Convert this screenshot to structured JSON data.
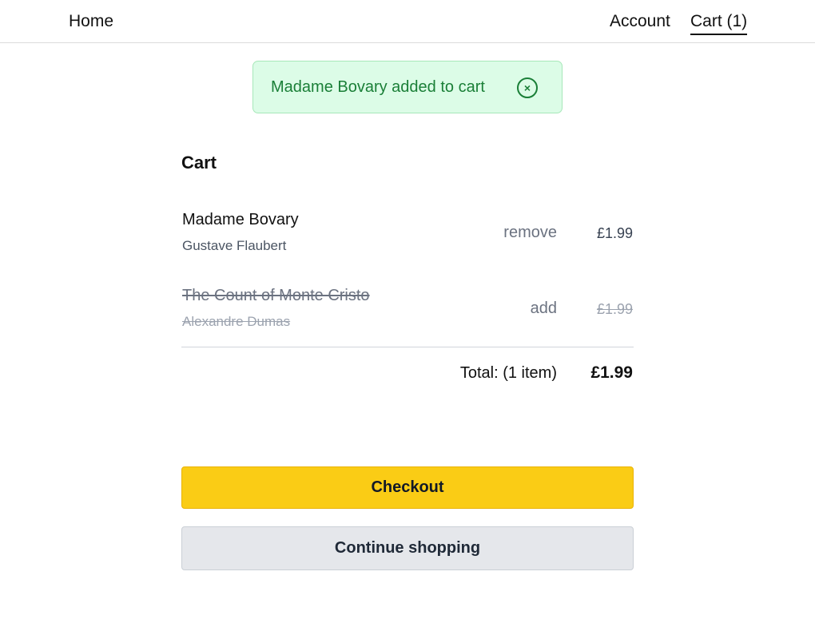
{
  "nav": {
    "home_label": "Home",
    "account_label": "Account",
    "cart_label": "Cart (1)"
  },
  "toast": {
    "message": "Madame Bovary added to cart",
    "close_glyph": "×",
    "background_color": "#dcfce7",
    "text_color": "#1a7f37"
  },
  "cart": {
    "title": "Cart",
    "items": [
      {
        "title": "Madame Bovary",
        "author": "Gustave Flaubert",
        "action_label": "remove",
        "price": "£1.99",
        "in_cart": true
      },
      {
        "title": "The Count of Monte Cristo",
        "author": "Alexandre Dumas",
        "action_label": "add",
        "price": "£1.99",
        "in_cart": false
      }
    ],
    "total_label": "Total: (1 item)",
    "total_value": "£1.99"
  },
  "buttons": {
    "checkout_label": "Checkout",
    "continue_label": "Continue shopping"
  },
  "colors": {
    "checkout_button": "#facc15",
    "continue_button": "#e5e7eb"
  }
}
